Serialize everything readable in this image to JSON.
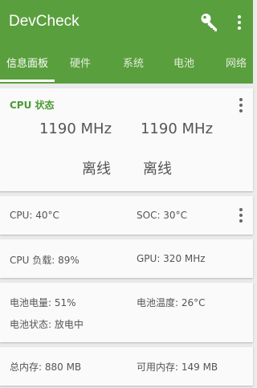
{
  "app": {
    "title": "DevCheck"
  },
  "toolbar": {
    "key_icon": "key-icon",
    "menu_icon": "more-vert-icon"
  },
  "tabs": [
    {
      "label": "信息面板",
      "active": true
    },
    {
      "label": "硬件",
      "active": false
    },
    {
      "label": "系统",
      "active": false
    },
    {
      "label": "电池",
      "active": false
    },
    {
      "label": "网络",
      "active": false
    }
  ],
  "cpu_card": {
    "title": "CPU 状态",
    "core_freq_1": "1190 MHz",
    "core_freq_2": "1190 MHz",
    "core_status_1": "离线",
    "core_status_2": "离线"
  },
  "temps": {
    "cpu": "CPU: 40°C",
    "soc": "SOC: 30°C"
  },
  "load": {
    "cpu": "CPU 负载: 89%",
    "gpu": "GPU: 320 MHz"
  },
  "battery": {
    "level": "电池电量: 51%",
    "temperature": "电池温度: 26°C",
    "status": "电池状态: 放电中"
  },
  "memory": {
    "total": "总内存: 880 MB",
    "available": "可用内存: 149 MB"
  },
  "colors": {
    "appbar": "#5a9f3e",
    "accent": "#4a9c34",
    "background": "#ebebeb",
    "card": "#fafafa"
  }
}
